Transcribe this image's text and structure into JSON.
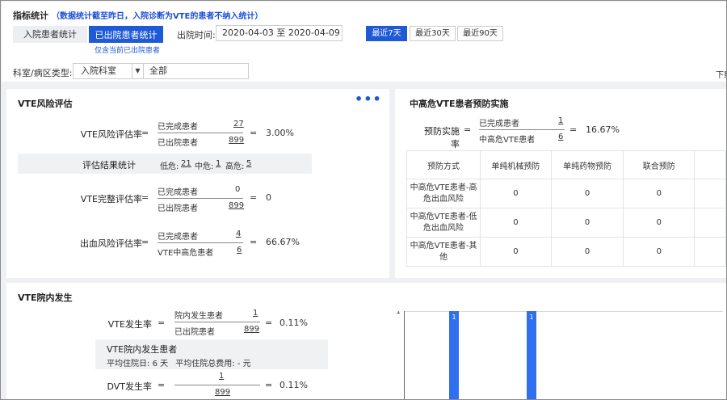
{
  "header": {
    "title": "指标统计",
    "title_note": "（数据统计截至昨日，入院诊断为VTE的患者不纳入统计）",
    "tab_inpatients": "入院患者统计",
    "tab_discharged": "已出院患者统计",
    "tab_note": "仅含当前已出院患者",
    "discharge_time_label": "出院时间:",
    "date_range": "2020-04-03 至 2020-04-09",
    "ranges": [
      "最近7天",
      "最近30天",
      "最近90天"
    ],
    "active_range": "最近7天",
    "dept_type_label": "科室/病区类型:",
    "dept_type_value": "入院科室",
    "dept_value": "全部",
    "download": "下载"
  },
  "risk_panel": {
    "title": "VTE风险评估",
    "rows": [
      {
        "label": "VTE风险评估率",
        "num_label": "已完成患者",
        "num": "27",
        "den_label": "已出院患者",
        "den": "899",
        "eq": "=",
        "result": "3.00%"
      },
      {
        "label": "VTE完整评估率",
        "num_label": "已完成患者",
        "num": "0",
        "den_label": "已出院患者",
        "den": "899",
        "eq": "=",
        "result": "0"
      },
      {
        "label": "出血风险评估率",
        "num_label": "已完成患者",
        "num": "4",
        "den_label": "VTE中高危患者",
        "den": "6",
        "eq": "=",
        "result": "66.67%"
      }
    ],
    "stats": {
      "label": "评估结果统计",
      "low_label": "低危:",
      "low": "21",
      "mid_label": "中危:",
      "mid": "1",
      "high_label": "高危:",
      "high": "5"
    },
    "lead_eq": "="
  },
  "prevention_panel": {
    "title": "中高危VTE患者预防实施",
    "rate_label": "预防实施率",
    "eq": "=",
    "num_label": "已完成患者",
    "num": "1",
    "den_label": "中高危VTE患者",
    "den": "6",
    "eq2": "=",
    "result": "16.67%",
    "columns": [
      "预防方式",
      "单纯机械预防",
      "单纯药物预防",
      "联合预防"
    ],
    "rows": [
      {
        "label": "中高危VTE患者-高危出血风险",
        "values": [
          "0",
          "0",
          "0"
        ]
      },
      {
        "label": "中高危VTE患者-低危出血风险",
        "values": [
          "0",
          "0",
          "0"
        ]
      },
      {
        "label": "中高危VTE患者-其他",
        "values": [
          "0",
          "0",
          "0"
        ]
      }
    ]
  },
  "occurrence_panel": {
    "title": "VTE院内发生",
    "rows": [
      {
        "label": "VTE发生率",
        "num_label": "院内发生患者",
        "num": "1",
        "den_label": "已出院患者",
        "den": "899",
        "eq": "=",
        "result": "0.11%"
      },
      {
        "label": "DVT发生率",
        "num_label": "",
        "num": "1",
        "den_label": "",
        "den": "899",
        "eq": "=",
        "result": "0.11%"
      }
    ],
    "lead_eq": "=",
    "patient_box": {
      "title": "VTE院内发生患者",
      "avg_days_label": "平均住院日:",
      "avg_days": "6 天",
      "avg_cost_label": "平均住院总费用:",
      "avg_cost": "- 元"
    }
  },
  "chart_data": {
    "type": "bar",
    "ylim": [
      0,
      1
    ],
    "ytick_labels": [
      "1"
    ],
    "bars": [
      {
        "value": 1,
        "label": "1"
      },
      {
        "value": 1,
        "label": "1"
      }
    ],
    "bar_color": "#2f6ff0"
  }
}
